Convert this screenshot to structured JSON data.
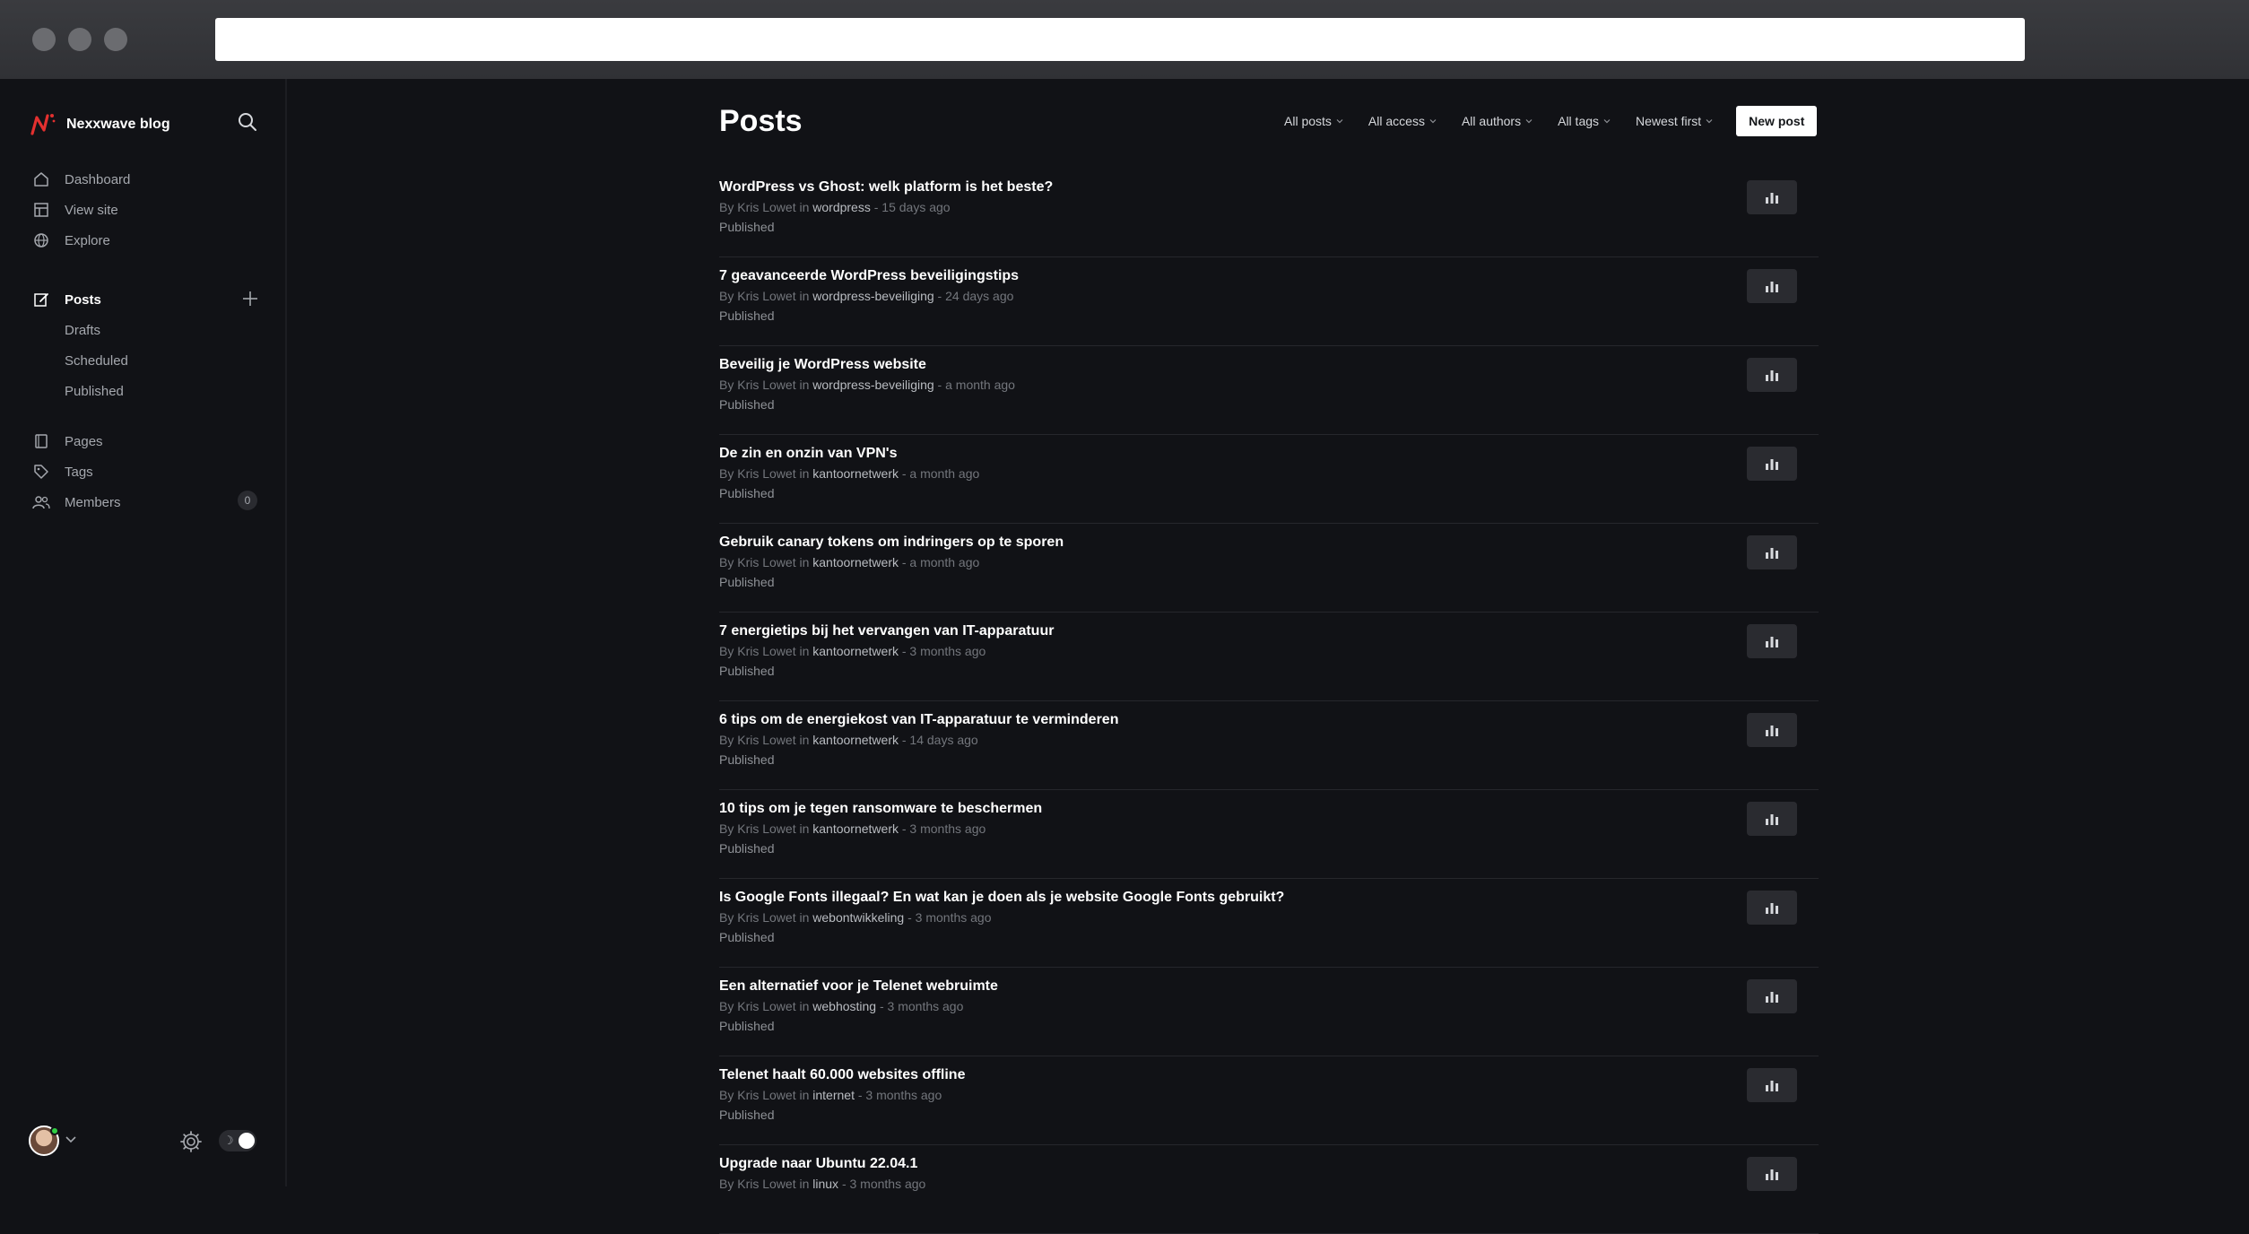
{
  "brand": {
    "name": "Nexxwave blog"
  },
  "nav": {
    "dashboard": "Dashboard",
    "view_site": "View site",
    "explore": "Explore",
    "posts": "Posts",
    "drafts": "Drafts",
    "scheduled": "Scheduled",
    "published": "Published",
    "pages": "Pages",
    "tags": "Tags",
    "members": "Members",
    "members_count": "0"
  },
  "header": {
    "title": "Posts",
    "filters": [
      "All posts",
      "All access",
      "All authors",
      "All tags",
      "Newest first"
    ],
    "new_post": "New post"
  },
  "posts": [
    {
      "title": "WordPress vs Ghost: welk platform is het beste?",
      "by": "By Kris Lowet in ",
      "tag": "wordpress",
      "time": " - 15 days ago",
      "status": "Published"
    },
    {
      "title": "7 geavanceerde WordPress beveiligingstips",
      "by": "By Kris Lowet in ",
      "tag": "wordpress-beveiliging",
      "time": " - 24 days ago",
      "status": "Published"
    },
    {
      "title": "Beveilig je WordPress website",
      "by": "By Kris Lowet in ",
      "tag": "wordpress-beveiliging",
      "time": " - a month ago",
      "status": "Published"
    },
    {
      "title": "De zin en onzin van VPN's",
      "by": "By Kris Lowet in ",
      "tag": "kantoornetwerk",
      "time": " - a month ago",
      "status": "Published"
    },
    {
      "title": "Gebruik canary tokens om indringers op te sporen",
      "by": "By Kris Lowet in ",
      "tag": "kantoornetwerk",
      "time": " - a month ago",
      "status": "Published"
    },
    {
      "title": "7 energietips bij het vervangen van IT-apparatuur",
      "by": "By Kris Lowet in ",
      "tag": "kantoornetwerk",
      "time": " - 3 months ago",
      "status": "Published"
    },
    {
      "title": "6 tips om de energiekost van IT-apparatuur te verminderen",
      "by": "By Kris Lowet in ",
      "tag": "kantoornetwerk",
      "time": " - 14 days ago",
      "status": "Published"
    },
    {
      "title": "10 tips om je tegen ransomware te beschermen",
      "by": "By Kris Lowet in ",
      "tag": "kantoornetwerk",
      "time": " - 3 months ago",
      "status": "Published"
    },
    {
      "title": "Is Google Fonts illegaal? En wat kan je doen als je website Google Fonts gebruikt?",
      "by": "By Kris Lowet in ",
      "tag": "webontwikkeling",
      "time": " - 3 months ago",
      "status": "Published"
    },
    {
      "title": "Een alternatief voor je Telenet webruimte",
      "by": "By Kris Lowet in ",
      "tag": "webhosting",
      "time": " - 3 months ago",
      "status": "Published"
    },
    {
      "title": "Telenet haalt 60.000 websites offline",
      "by": "By Kris Lowet in ",
      "tag": "internet",
      "time": " - 3 months ago",
      "status": "Published"
    },
    {
      "title": "Upgrade naar Ubuntu 22.04.1",
      "by": "By Kris Lowet in ",
      "tag": "linux",
      "time": " - 3 months ago",
      "status": ""
    }
  ],
  "icons": {
    "search": "search-icon",
    "dashboard": "home-icon",
    "view_site": "layout-icon",
    "explore": "globe-icon",
    "posts": "edit-icon",
    "pages": "page-icon",
    "tags": "tag-icon",
    "members": "members-icon",
    "stats": "bar-chart-icon",
    "settings": "gear-icon",
    "theme": "moon-icon"
  },
  "colors": {
    "accent": "#ffffff",
    "logo_red": "#e3302f",
    "online": "#30cf43"
  }
}
